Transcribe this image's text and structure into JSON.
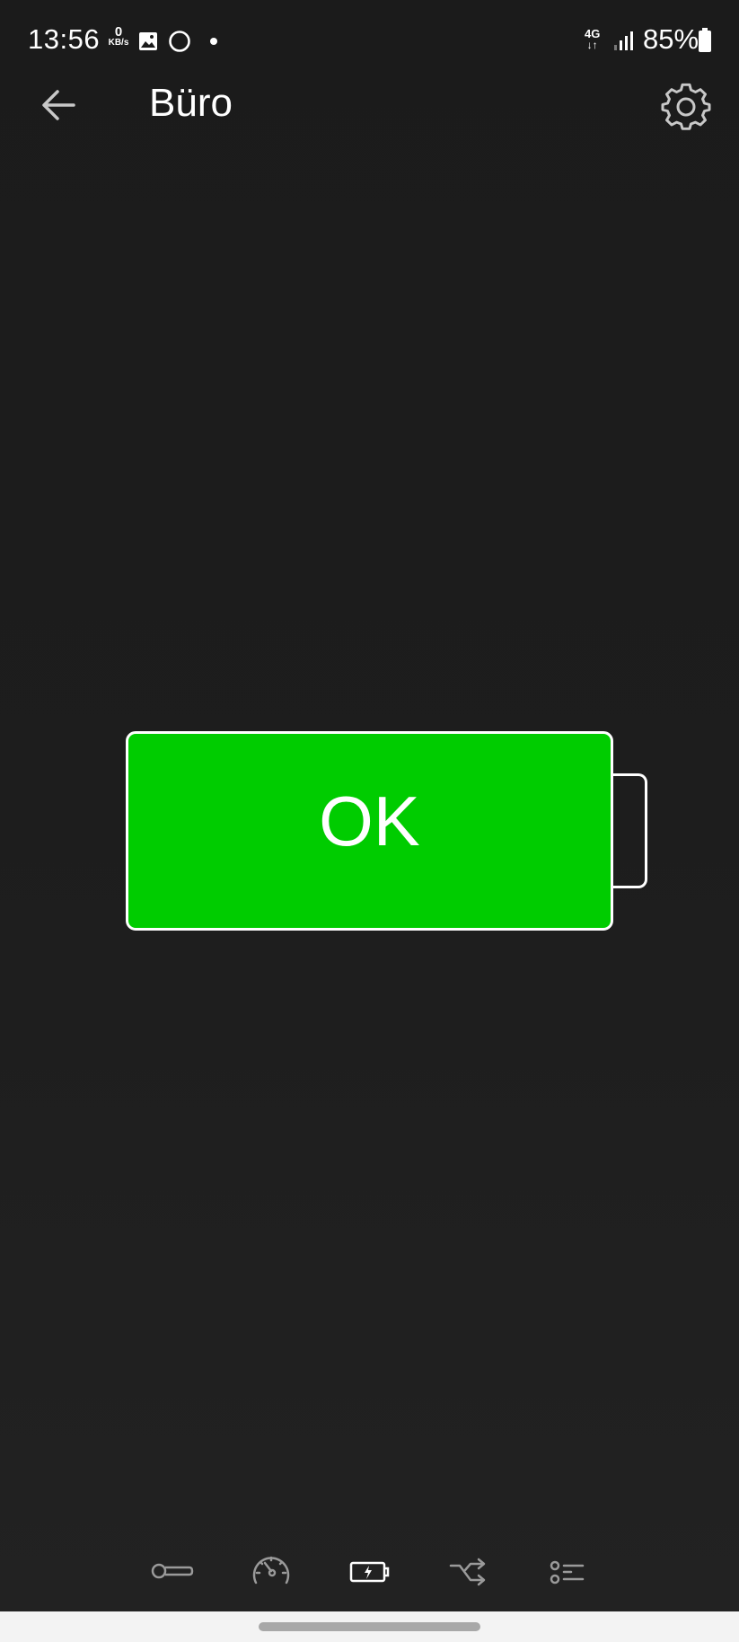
{
  "status_bar": {
    "time": "13:56",
    "net_speed_value": "0",
    "net_speed_unit": "KB/s",
    "network_type": "4G",
    "battery_percent": "85%",
    "icons": [
      "gallery-icon",
      "circle-icon",
      "dot-icon",
      "signal-icon",
      "battery-icon"
    ]
  },
  "app_bar": {
    "title": "Büro",
    "back_icon": "arrow-left-icon",
    "settings_icon": "gear-icon"
  },
  "battery_status": {
    "label": "OK",
    "fill_color": "#00cc00"
  },
  "bottom_nav": {
    "items": [
      {
        "icon": "thermometer-icon"
      },
      {
        "icon": "speedometer-icon"
      },
      {
        "icon": "battery-charging-icon",
        "active": true
      },
      {
        "icon": "shuffle-icon"
      },
      {
        "icon": "list-icon"
      }
    ]
  }
}
